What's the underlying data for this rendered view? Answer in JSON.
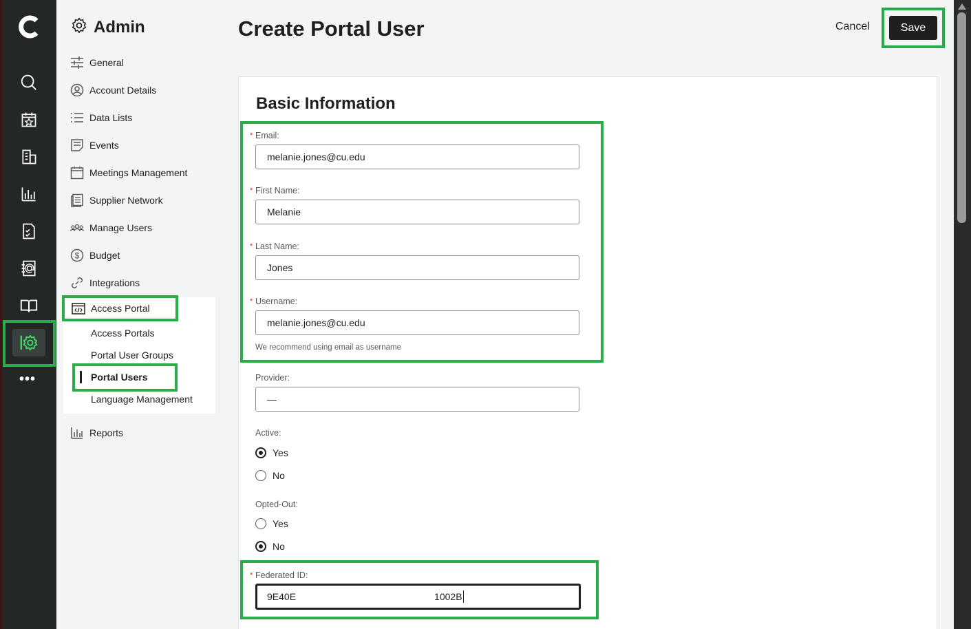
{
  "nav": {
    "title": "Admin",
    "items": [
      {
        "label": "General",
        "icon": "sliders-icon"
      },
      {
        "label": "Account Details",
        "icon": "user-circle-icon"
      },
      {
        "label": "Data Lists",
        "icon": "list-icon"
      },
      {
        "label": "Events",
        "icon": "events-icon"
      },
      {
        "label": "Meetings Management",
        "icon": "calendar-icon"
      },
      {
        "label": "Supplier Network",
        "icon": "supplier-icon"
      },
      {
        "label": "Manage Users",
        "icon": "users-icon"
      },
      {
        "label": "Budget",
        "icon": "dollar-icon"
      },
      {
        "label": "Integrations",
        "icon": "link-icon"
      }
    ],
    "access_portal": {
      "label": "Access Portal",
      "sub_items": [
        "Access Portals",
        "Portal User Groups",
        "Portal Users",
        "Language Management"
      ],
      "active_sub": "Portal Users"
    },
    "reports": "Reports"
  },
  "header": {
    "title": "Create Portal User",
    "cancel_label": "Cancel",
    "save_label": "Save"
  },
  "form": {
    "section_title": "Basic Information",
    "required_mark": "*",
    "email": {
      "label": "Email:",
      "value": "melanie.jones@cu.edu"
    },
    "first_name": {
      "label": "First Name:",
      "value": "Melanie"
    },
    "last_name": {
      "label": "Last Name:",
      "value": "Jones"
    },
    "username": {
      "label": "Username:",
      "value": "melanie.jones@cu.edu",
      "hint": "We recommend using email as username"
    },
    "provider": {
      "label": "Provider:",
      "value": "—"
    },
    "active": {
      "label": "Active:",
      "options": [
        "Yes",
        "No"
      ],
      "selected": "Yes"
    },
    "opted_out": {
      "label": "Opted-Out:",
      "options": [
        "Yes",
        "No"
      ],
      "selected": "No"
    },
    "federated_id": {
      "label": "Federated ID:",
      "value_part1": "9E40E",
      "value_part2": "1002B"
    }
  },
  "colors": {
    "highlight": "#27ae4a",
    "rail_bg": "#232826",
    "accent_green": "#3ddc6b",
    "required": "#d1321e"
  }
}
